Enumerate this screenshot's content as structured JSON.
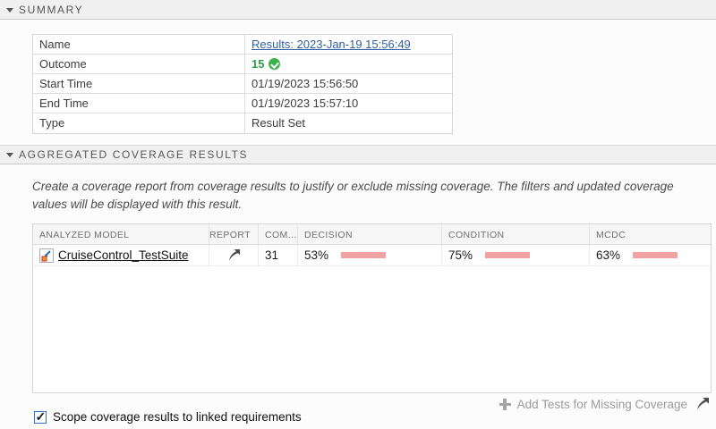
{
  "summary": {
    "header": "SUMMARY",
    "rows": {
      "name": {
        "label": "Name",
        "value": "Results: 2023-Jan-19 15:56:49"
      },
      "outcome": {
        "label": "Outcome",
        "value": "15"
      },
      "start_time": {
        "label": "Start Time",
        "value": "01/19/2023 15:56:50"
      },
      "end_time": {
        "label": "End Time",
        "value": "01/19/2023 15:57:10"
      },
      "type": {
        "label": "Type",
        "value": "Result Set"
      }
    }
  },
  "coverage": {
    "header": "AGGREGATED COVERAGE RESULTS",
    "description": "Create a coverage report from coverage results to justify or exclude missing coverage. The filters and updated coverage values will be displayed with this result.",
    "table": {
      "columns": {
        "model": "ANALYZED MODEL",
        "report": "REPORT",
        "complexity": "COM...",
        "decision": "DECISION",
        "condition": "CONDITION",
        "mcdc": "MCDC"
      },
      "rows": {
        "0": {
          "model": "CruiseControl_TestSuite",
          "complexity": "31",
          "decision": {
            "label": "53%",
            "pct": 53
          },
          "condition": {
            "label": "75%",
            "pct": 75
          },
          "mcdc": {
            "label": "63%",
            "pct": 63
          }
        }
      }
    },
    "add_tests_label": "Add Tests for Missing Coverage"
  },
  "footer": {
    "checkbox_label": "Scope coverage results to linked requirements",
    "checked": true
  },
  "colors": {
    "covered_bar": "#0a0adf",
    "uncovered_bar": "#f2a2a2",
    "pass_green": "#2e9e49",
    "link_blue": "#2e5fa3",
    "band_bg": "#f0f0f0"
  }
}
